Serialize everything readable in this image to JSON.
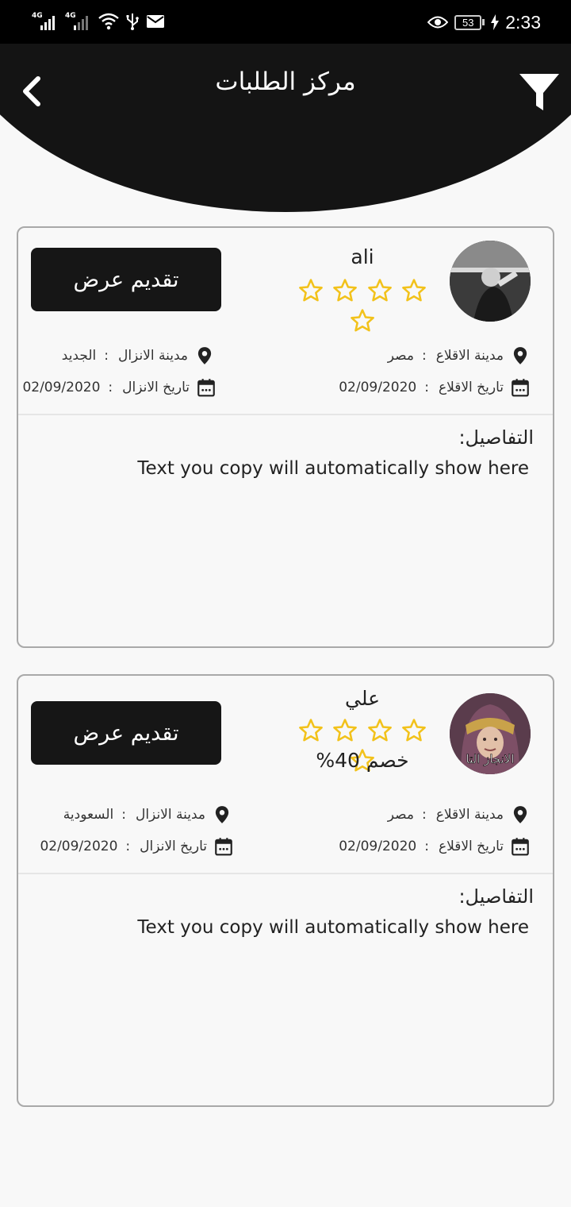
{
  "status_bar": {
    "signal1_label": "4G",
    "signal2_label": "4G",
    "battery_level": "53",
    "time": "2:33",
    "icons": [
      "signal-icon",
      "wifi-icon",
      "usb-icon",
      "mail-icon",
      "eye-icon",
      "battery-icon",
      "charging-icon"
    ]
  },
  "header": {
    "title": "مركز الطلبات",
    "back_icon": "chevron-left-icon",
    "filter_icon": "filter-icon",
    "background": "#141414"
  },
  "requests": [
    {
      "name": "ali",
      "rating_stars": 5,
      "offer_label": "تقديم عرض",
      "origin_label": "مدينة الاقلاع",
      "origin_value": "مصر",
      "destination_label": "مدينة الانزال",
      "destination_value": "الجديد",
      "departure_date_label": "تاريخ الاقلاع",
      "departure_date_value": "02/09/2020",
      "arrival_date_label": "تاريخ الانزال",
      "arrival_date_value": "02/09/2020",
      "details_label": "التفاصيل:",
      "details_text": "Text you copy will automatically show here"
    },
    {
      "name": "علي",
      "rating_stars": 5,
      "discount": "خصم 40%",
      "avatar_caption": "الانجاز التا",
      "offer_label": "تقديم عرض",
      "origin_label": "مدينة الاقلاع",
      "origin_value": "مصر",
      "destination_label": "مدينة الانزال",
      "destination_value": "السعودية",
      "departure_date_label": "تاريخ الاقلاع",
      "departure_date_value": "02/09/2020",
      "arrival_date_label": "تاريخ الانزال",
      "arrival_date_value": "02/09/2020",
      "details_label": "التفاصيل:",
      "details_text": "Text you copy will automatically show here"
    }
  ],
  "colors": {
    "star": "#f2c21b",
    "button": "#161616",
    "card_border": "#a9a9a9"
  }
}
